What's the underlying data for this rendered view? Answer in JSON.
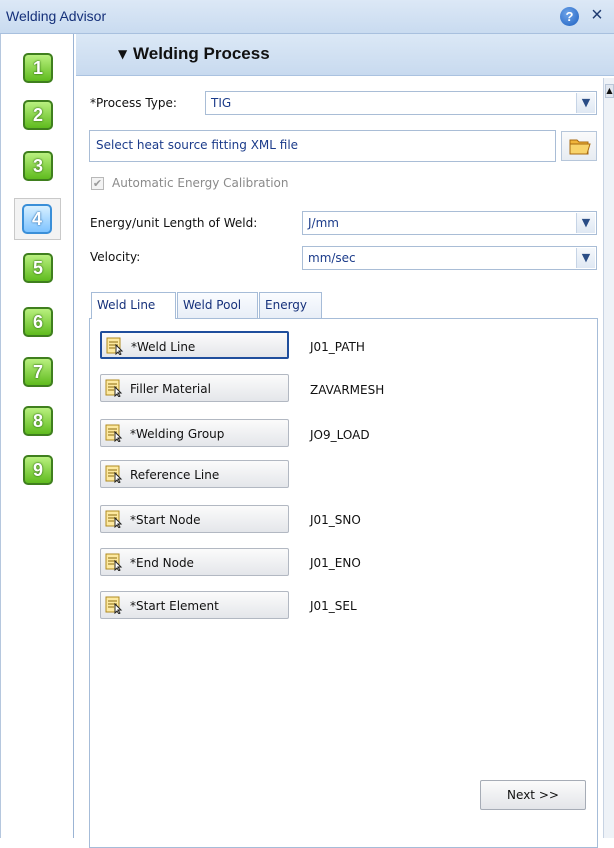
{
  "window": {
    "title": "Welding Advisor",
    "help_icon": "?",
    "close_icon": "×"
  },
  "steps": [
    "1",
    "2",
    "3",
    "4",
    "5",
    "6",
    "7",
    "8",
    "9"
  ],
  "active_step": "4",
  "section": {
    "arrow": "▼",
    "title": "Welding Process"
  },
  "process_type": {
    "label": "*Process Type:",
    "value": "TIG"
  },
  "heat_source": {
    "placeholder": "Select heat source fitting XML file"
  },
  "auto_energy": {
    "label": "Automatic Energy Calibration",
    "checked": true,
    "disabled": true
  },
  "energy": {
    "label": "Energy/unit Length of Weld:",
    "value": "J/mm"
  },
  "velocity": {
    "label": "Velocity:",
    "value": "mm/sec"
  },
  "tabs": [
    "Weld Line",
    "Weld Pool",
    "Energy"
  ],
  "selections": [
    {
      "label": "*Weld Line",
      "value": "J01_PATH"
    },
    {
      "label": "Filler Material",
      "value": "ZAVARMESH"
    },
    {
      "label": "*Welding Group",
      "value": "JO9_LOAD"
    },
    {
      "label": "Reference Line",
      "value": ""
    },
    {
      "label": "*Start Node",
      "value": "J01_SNO"
    },
    {
      "label": "*End Node",
      "value": "J01_ENO"
    },
    {
      "label": "*Start Element",
      "value": "J01_SEL"
    }
  ],
  "next_label": "Next >>",
  "colors": {
    "accent": "#1b3b8a",
    "step_green": "#5fbb1e",
    "header_bg": "#c8daef"
  }
}
